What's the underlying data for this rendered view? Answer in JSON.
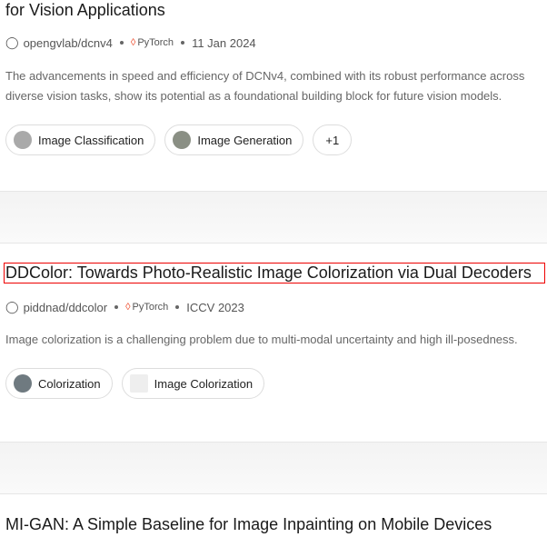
{
  "papers": [
    {
      "title": "for Vision Applications",
      "repo": "opengvlab/dcnv4",
      "framework": "PyTorch",
      "date": "11 Jan 2024",
      "abstract": "The advancements in speed and efficiency of DCNv4, combined with its robust performance across diverse vision tasks, show its potential as a foundational building block for future vision models.",
      "tags": [
        "Image Classification",
        "Image Generation"
      ],
      "more": "+1"
    },
    {
      "title": "DDColor: Towards Photo-Realistic Image Colorization via Dual Decoders",
      "repo": "piddnad/ddcolor",
      "framework": "PyTorch",
      "date": "ICCV 2023",
      "abstract": "Image colorization is a challenging problem due to multi-modal uncertainty and high ill-posedness.",
      "tags": [
        "Colorization",
        "Image Colorization"
      ]
    },
    {
      "title": "MI-GAN: A Simple Baseline for Image Inpainting on Mobile Devices"
    }
  ]
}
